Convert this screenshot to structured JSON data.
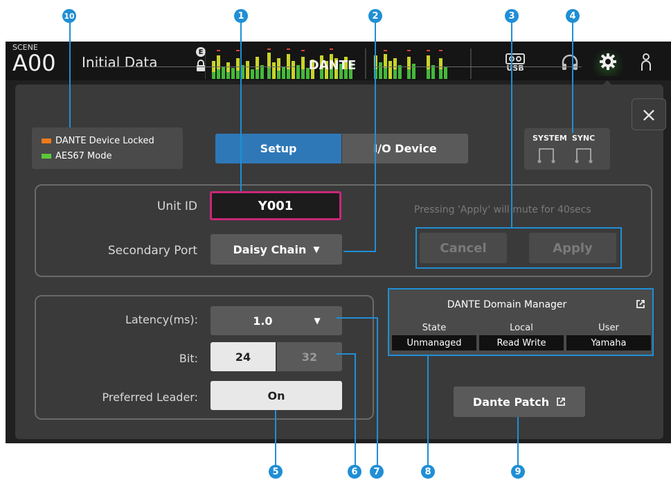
{
  "scene": {
    "label": "SCENE",
    "number": "A00",
    "name": "Initial Data"
  },
  "indicators": {
    "e_badge": "E"
  },
  "topbar": {
    "usb_label": "USB"
  },
  "panel": {
    "title": "DANTE"
  },
  "status": {
    "device_locked": "DANTE Device Locked",
    "aes67": "AES67 Mode"
  },
  "tabs": [
    {
      "label": "Setup",
      "active": true
    },
    {
      "label": "I/O Device",
      "active": false
    }
  ],
  "system_sync": {
    "label_system": "SYSTEM",
    "label_sync": "SYNC"
  },
  "unit_id": {
    "label": "Unit ID",
    "value": "Y001"
  },
  "secondary_port": {
    "label": "Secondary Port",
    "value": "Daisy Chain"
  },
  "apply_note": "Pressing 'Apply' will mute for 40secs",
  "actions": {
    "cancel": "Cancel",
    "apply": "Apply"
  },
  "latency": {
    "label": "Latency(ms):",
    "value": "1.0"
  },
  "bit": {
    "label": "Bit:",
    "options": [
      "24",
      "32"
    ],
    "selected": "24"
  },
  "preferred_leader": {
    "label": "Preferred Leader:",
    "value": "On"
  },
  "ddm": {
    "title": "DANTE Domain Manager",
    "columns": [
      {
        "header": "State",
        "value": "Unmanaged"
      },
      {
        "header": "Local",
        "value": "Read Write"
      },
      {
        "header": "User",
        "value": "Yamaha"
      }
    ]
  },
  "dante_patch": {
    "label": "Dante Patch"
  },
  "callouts": [
    "1",
    "2",
    "3",
    "4",
    "5",
    "6",
    "7",
    "8",
    "9",
    "10"
  ],
  "colors": {
    "accent_blue": "#1f8fd6",
    "locked_orange": "#f07a1a",
    "aes67_green": "#5ac83a",
    "unit_id_border": "#c8287a"
  }
}
